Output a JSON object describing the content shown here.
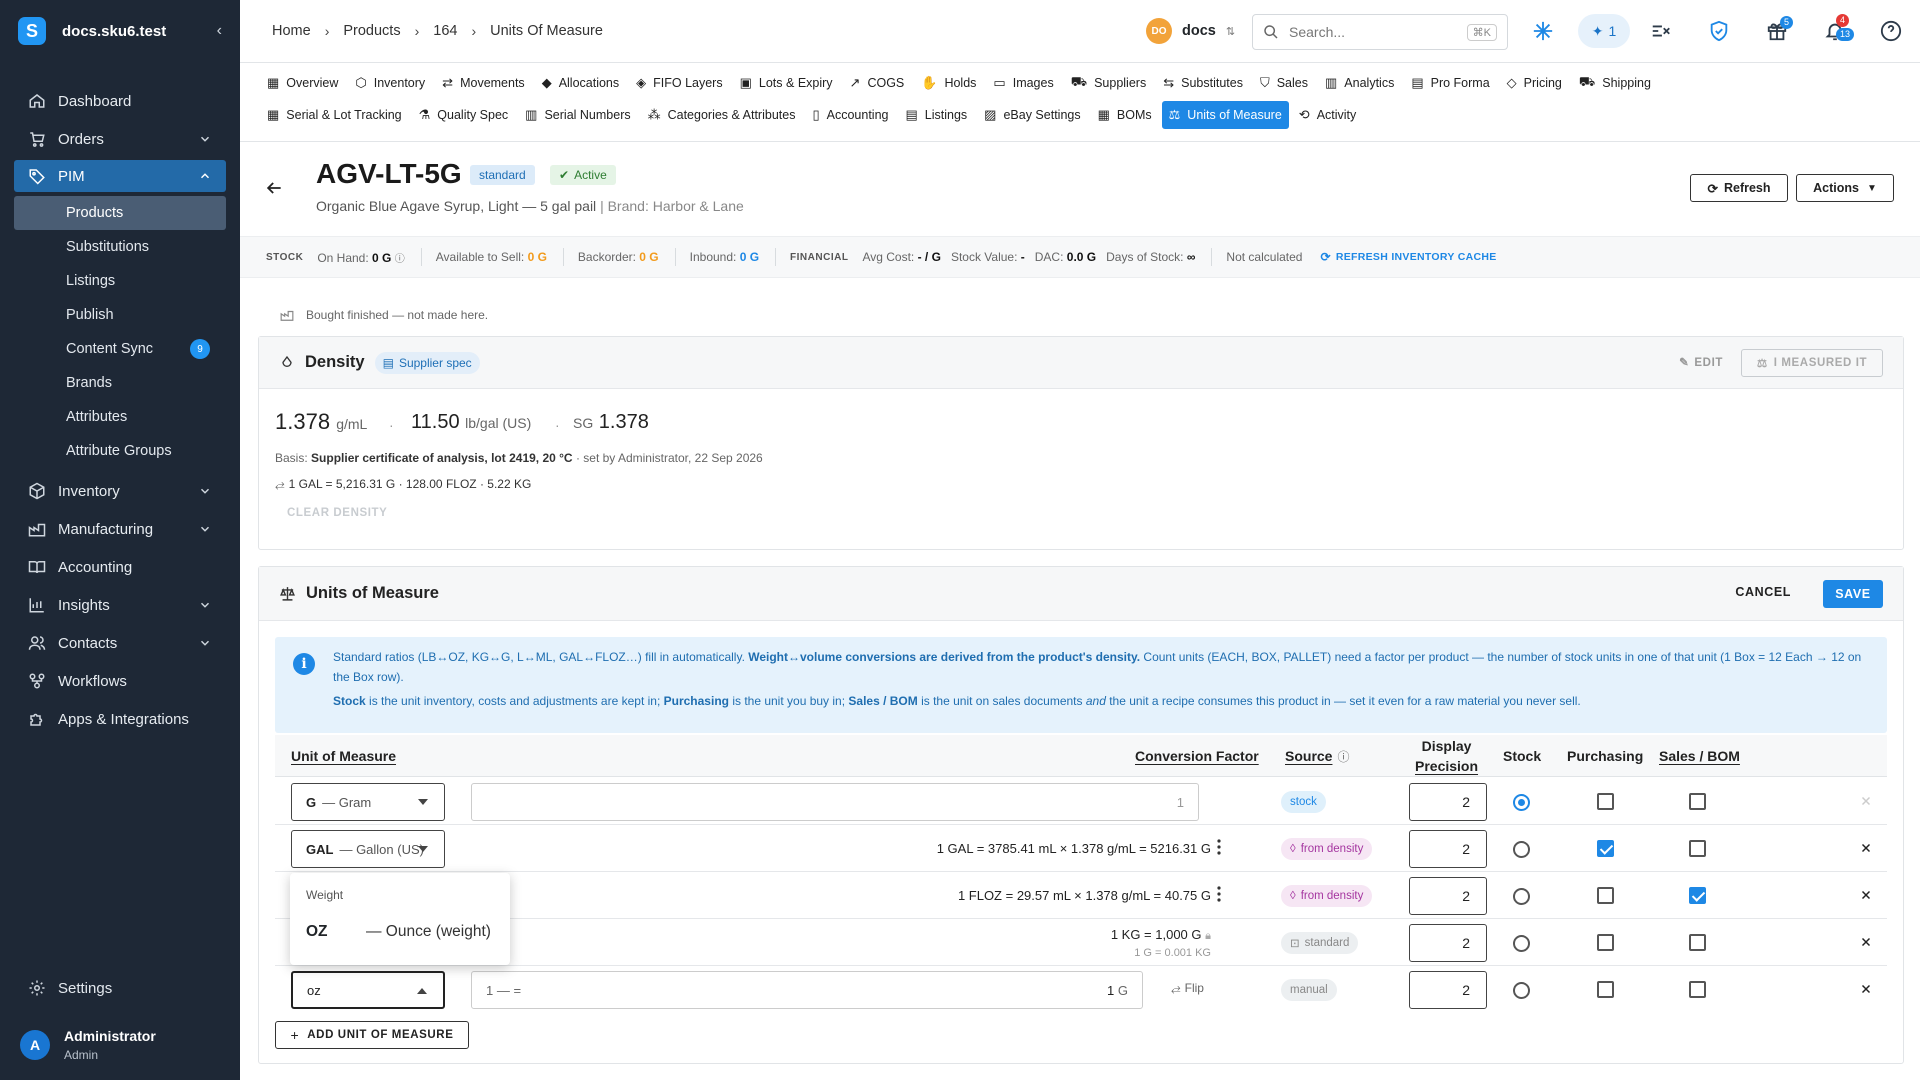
{
  "sidebar": {
    "brand": "docs.sku6.test",
    "items": [
      {
        "label": "Dashboard"
      },
      {
        "label": "Orders"
      },
      {
        "label": "PIM"
      },
      {
        "label": "Inventory"
      },
      {
        "label": "Manufacturing"
      },
      {
        "label": "Accounting"
      },
      {
        "label": "Insights"
      },
      {
        "label": "Contacts"
      },
      {
        "label": "Workflows"
      },
      {
        "label": "Apps & Integrations"
      }
    ],
    "pim_sub": [
      {
        "label": "Products"
      },
      {
        "label": "Substitutions"
      },
      {
        "label": "Listings"
      },
      {
        "label": "Publish"
      },
      {
        "label": "Content Sync",
        "badge": "9"
      },
      {
        "label": "Brands"
      },
      {
        "label": "Attributes"
      },
      {
        "label": "Attribute Groups"
      }
    ],
    "settings": "Settings",
    "user": {
      "initial": "A",
      "name": "Administrator",
      "role": "Admin"
    }
  },
  "topbar": {
    "breadcrumb": [
      "Home",
      "Products",
      "164",
      "Units Of Measure"
    ],
    "workspace": {
      "initials": "DO",
      "name": "docs"
    },
    "search_placeholder": "Search...",
    "search_shortcut": "⌘K",
    "ai_count": "1",
    "gift_badge": "5",
    "notif_badge_top": "4",
    "notif_badge_bottom": "13"
  },
  "tabs": {
    "row1": [
      "Overview",
      "Inventory",
      "Movements",
      "Allocations",
      "FIFO Layers",
      "Lots & Expiry",
      "COGS",
      "Holds",
      "Images",
      "Suppliers",
      "Substitutes",
      "Sales",
      "Analytics",
      "Pro Forma",
      "Pricing",
      "Shipping"
    ],
    "row2": [
      "Serial & Lot Tracking",
      "Quality Spec",
      "Serial Numbers",
      "Categories & Attributes",
      "Accounting",
      "Listings",
      "eBay Settings",
      "BOMs",
      "Units of Measure",
      "Activity"
    ],
    "active": "Units of Measure"
  },
  "product": {
    "sku": "AGV-LT-5G",
    "type_pill": "standard",
    "status_pill": "Active",
    "name": "Organic Blue Agave Syrup, Light — 5 gal pail",
    "brand": "| Brand: Harbor & Lane",
    "refresh_btn": "Refresh",
    "actions_btn": "Actions"
  },
  "stockbar": {
    "stock_caption": "STOCK",
    "on_hand_label": "On Hand:",
    "on_hand": "0 G",
    "avail_label": "Available to Sell:",
    "avail": "0 G",
    "backorder_label": "Backorder:",
    "backorder": "0 G",
    "inbound_label": "Inbound:",
    "inbound": "0 G",
    "financial_caption": "FINANCIAL",
    "avg_cost_label": "Avg Cost:",
    "avg_cost": "- / G",
    "stock_value_label": "Stock Value:",
    "stock_value": "-",
    "dac_label": "DAC:",
    "dac": "0.0 G",
    "days_label": "Days of Stock:",
    "days": "∞",
    "not_calc": "Not calculated",
    "refresh_cache": "REFRESH INVENTORY CACHE"
  },
  "bought_note": "Bought finished — not made here.",
  "density": {
    "title": "Density",
    "chip": "Supplier spec",
    "edit": "EDIT",
    "measured": "I MEASURED IT",
    "gml_value": "1.378",
    "gml_unit": "g/mL",
    "lbgal_value": "11.50",
    "lbgal_unit": "lb/gal (US)",
    "sg_label": "SG",
    "sg_value": "1.378",
    "basis_label": "Basis:",
    "basis_value": "Supplier certificate of analysis, lot 2419, 20 °C",
    "basis_meta": "· set by Administrator, 22 Sep 2026",
    "conversions": "1 GAL = 5,216.31 G · 128.00 FLOZ · 5.22 KG",
    "clear": "CLEAR DENSITY"
  },
  "uom": {
    "title": "Units of Measure",
    "cancel": "CANCEL",
    "save": "SAVE",
    "info_line1_a": "Standard ratios (LB↔OZ, KG↔G, L↔ML, GAL↔FLOZ…) fill in automatically. ",
    "info_line1_b": "Weight↔volume conversions are derived from the product's density.",
    "info_line1_c": " Count units (EACH, BOX, PALLET) need a factor per product — the number of stock units in one of that unit (1 Box = 12 Each → 12 on the Box row).",
    "info_line2_a": "Stock",
    "info_line2_b": " is the unit inventory, costs and adjustments are kept in; ",
    "info_line2_c": "Purchasing",
    "info_line2_d": " is the unit you buy in; ",
    "info_line2_e": "Sales / BOM",
    "info_line2_f": " is the unit on sales documents ",
    "info_line2_g": "and",
    "info_line2_h": " the unit a recipe consumes this product in — set it even for a raw material you never sell.",
    "headers": {
      "unit": "Unit of Measure",
      "factor": "Conversion Factor",
      "source": "Source",
      "precision_1": "Display",
      "precision_2": "Precision",
      "stock": "Stock",
      "purchasing": "Purchasing",
      "sales": "Sales / BOM"
    },
    "rows": [
      {
        "code": "G",
        "name": "— Gram",
        "factor_input": "1",
        "source": "stock",
        "precision": "2",
        "stock": true,
        "purchasing": false,
        "sales": false
      },
      {
        "code": "GAL",
        "name": "— Gallon (US)",
        "factor": "1 GAL = 3785.41 mL × 1.378 g/mL = 5216.31 G",
        "source": "from density",
        "precision": "2",
        "stock": false,
        "purchasing": true,
        "sales": false
      },
      {
        "factor": "1 FLOZ = 29.57 mL × 1.378 g/mL = 40.75 G",
        "source": "from density",
        "precision": "2",
        "stock": false,
        "purchasing": false,
        "sales": true
      },
      {
        "factor": "1 KG = 1,000 G",
        "factor_sub": "1 G = 0.001 KG",
        "source": "standard",
        "precision": "2",
        "stock": false,
        "purchasing": false,
        "sales": false
      },
      {
        "code_input": "oz",
        "factor_prefix": "1 — =",
        "factor_value": "1",
        "factor_unit": "G",
        "flip": "Flip",
        "source": "manual",
        "precision": "2",
        "stock": false,
        "purchasing": false,
        "sales": false
      }
    ],
    "dropdown": {
      "group": "Weight",
      "option_code": "OZ",
      "option_name": "— Ounce (weight)"
    },
    "add_button": "ADD UNIT OF MEASURE"
  },
  "colors": {
    "accent": "#1e88e5",
    "sidebar": "#1e2836",
    "density_chip": "#a536a0"
  }
}
